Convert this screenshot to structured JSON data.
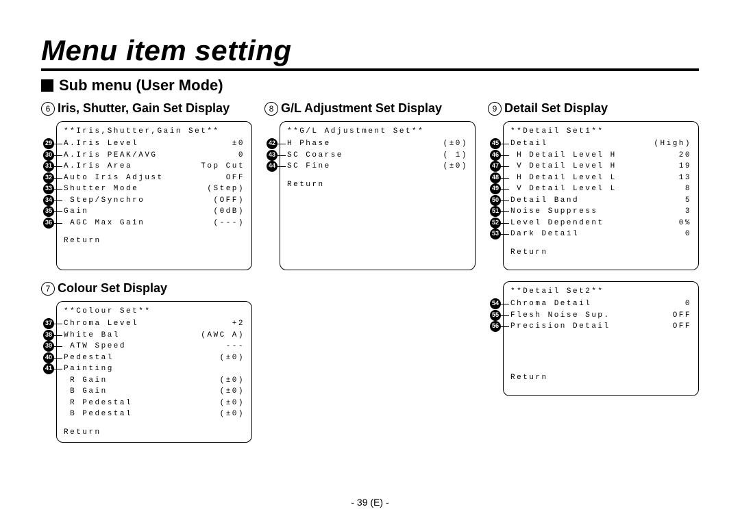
{
  "page_title": "Menu item setting",
  "section": "Sub menu (User Mode)",
  "footer": "- 39 (E) -",
  "return_label": "Return",
  "panels": {
    "iris": {
      "circ": "6",
      "title": "Iris, Shutter, Gain Set Display",
      "header": "**Iris,Shutter,Gain Set**",
      "rows": [
        {
          "n": "29",
          "label": "A.Iris Level",
          "val": "±0"
        },
        {
          "n": "30",
          "label": "A.Iris PEAK/AVG",
          "val": "0"
        },
        {
          "n": "31",
          "label": "A.Iris Area",
          "val": "Top Cut"
        },
        {
          "n": "32",
          "label": "Auto Iris Adjust",
          "val": "OFF"
        },
        {
          "n": "33",
          "label": "Shutter Mode",
          "val": "(Step)"
        },
        {
          "n": "34",
          "label": " Step/Synchro",
          "val": "(OFF)"
        },
        {
          "n": "35",
          "label": "Gain",
          "val": "(0dB)"
        },
        {
          "n": "36",
          "label": " AGC Max Gain",
          "val": "(---)"
        }
      ]
    },
    "colour": {
      "circ": "7",
      "title": "Colour Set Display",
      "header": "**Colour Set**",
      "rows": [
        {
          "n": "37",
          "label": "Chroma Level",
          "val": "+2"
        },
        {
          "n": "38",
          "label": "White Bal",
          "val": "(AWC A)"
        },
        {
          "n": "39",
          "label": " ATW Speed",
          "val": "---"
        },
        {
          "n": "40",
          "label": "Pedestal",
          "val": "(±0)"
        },
        {
          "n": "41",
          "label": "Painting",
          "val": ""
        },
        {
          "n": "",
          "label": " R Gain",
          "val": "(±0)"
        },
        {
          "n": "",
          "label": " B Gain",
          "val": "(±0)"
        },
        {
          "n": "",
          "label": " R Pedestal",
          "val": "(±0)"
        },
        {
          "n": "",
          "label": " B Pedestal",
          "val": "(±0)"
        }
      ]
    },
    "gl": {
      "circ": "8",
      "title": "G/L Adjustment Set Display",
      "header": "**G/L Adjustment Set**",
      "rows": [
        {
          "n": "42",
          "label": "H Phase",
          "val": "(±0)"
        },
        {
          "n": "43",
          "label": "SC Coarse",
          "val": "( 1)"
        },
        {
          "n": "44",
          "label": "SC Fine",
          "val": "(±0)"
        }
      ]
    },
    "detail1": {
      "circ": "9",
      "title": "Detail Set Display",
      "header": "**Detail Set1**",
      "rows": [
        {
          "n": "45",
          "label": "Detail",
          "val": "(High)"
        },
        {
          "n": "46",
          "label": " H Detail Level H",
          "val": "20"
        },
        {
          "n": "47",
          "label": " V Detail Level H",
          "val": "19"
        },
        {
          "n": "48",
          "label": " H Detail Level L",
          "val": "13"
        },
        {
          "n": "49",
          "label": " V Detail Level L",
          "val": "8"
        },
        {
          "n": "50",
          "label": "Detail Band",
          "val": "5"
        },
        {
          "n": "51",
          "label": "Noise Suppress",
          "val": "3"
        },
        {
          "n": "52",
          "label": "Level Dependent",
          "val": "0%"
        },
        {
          "n": "53",
          "label": "Dark Detail",
          "val": "0"
        }
      ]
    },
    "detail2": {
      "header": "**Detail Set2**",
      "rows": [
        {
          "n": "54",
          "label": "Chroma Detail",
          "val": "0"
        },
        {
          "n": "55",
          "label": "Flesh Noise Sup.",
          "val": "OFF"
        },
        {
          "n": "56",
          "label": "Precision Detail",
          "val": "OFF"
        }
      ]
    }
  }
}
